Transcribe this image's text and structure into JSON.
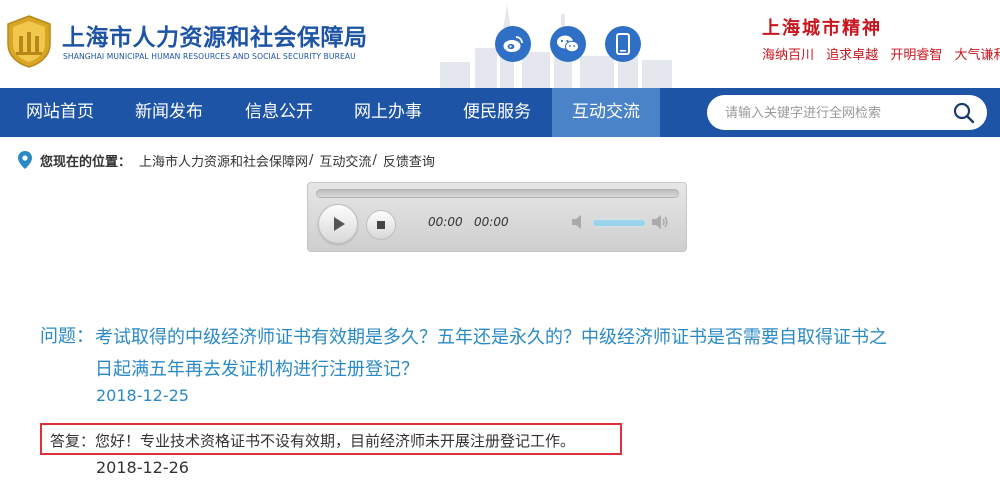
{
  "site": {
    "title_cn": "上海市人力资源和社会保障局",
    "title_en": "SHANGHAI MUNICIPAL HUMAN RESOURCES AND SOCIAL SECURITY BUREAU",
    "brand_color": "#1d54a5"
  },
  "social": {
    "weibo": "weibo-icon",
    "wechat": "wechat-icon",
    "mobile": "mobile-icon"
  },
  "motto": {
    "title": "上海城市精神",
    "phrases": [
      "海纳百川",
      "追求卓越",
      "开明睿智",
      "大气谦和"
    ],
    "color": "#c8161e"
  },
  "nav": {
    "items": [
      {
        "label": "网站首页"
      },
      {
        "label": "新闻发布"
      },
      {
        "label": "信息公开"
      },
      {
        "label": "网上办事"
      },
      {
        "label": "便民服务"
      },
      {
        "label": "互动交流",
        "active": true
      }
    ],
    "search_placeholder": "请输入关键字进行全网检索"
  },
  "breadcrumb": {
    "label": "您现在的位置：",
    "items": [
      "上海市人力资源和社会保障网",
      "互动交流",
      "反馈查询"
    ],
    "separator": "/"
  },
  "player": {
    "current_time": "00:00",
    "total_time": "00:00",
    "progress": 0
  },
  "qa": {
    "question_label": "问题：",
    "question": "考试取得的中级经济师证书有效期是多久？五年还是永久的？中级经济师证书是否需要自取得证书之日起满五年再去发证机构进行注册登记？",
    "question_date": "2018-12-25",
    "answer": "答复：您好！专业技术资格证书不设有效期，目前经济师未开展注册登记工作。",
    "answer_date": "2018-12-26",
    "highlight_color": "#e0303c"
  }
}
